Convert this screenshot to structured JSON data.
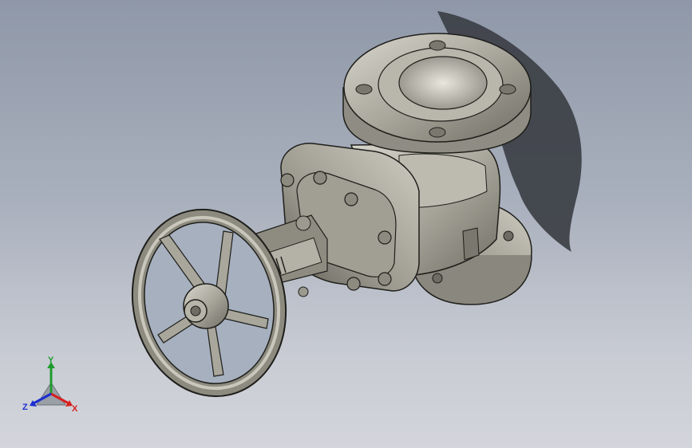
{
  "app": {
    "title": ""
  },
  "model": {
    "name": "gate-valve"
  },
  "triad": {
    "x_label": "X",
    "y_label": "Y",
    "z_label": "Z",
    "x_color": "#d62020",
    "y_color": "#1f9a2e",
    "z_color": "#1c2fd0"
  },
  "colors": {
    "background_top": "#8f98a8",
    "background_bottom": "#d3d5db",
    "metal": "#a9a79c",
    "metal_dark": "#5a5850",
    "edge": "#1e1e1a",
    "shadow": "#3c3f45"
  }
}
